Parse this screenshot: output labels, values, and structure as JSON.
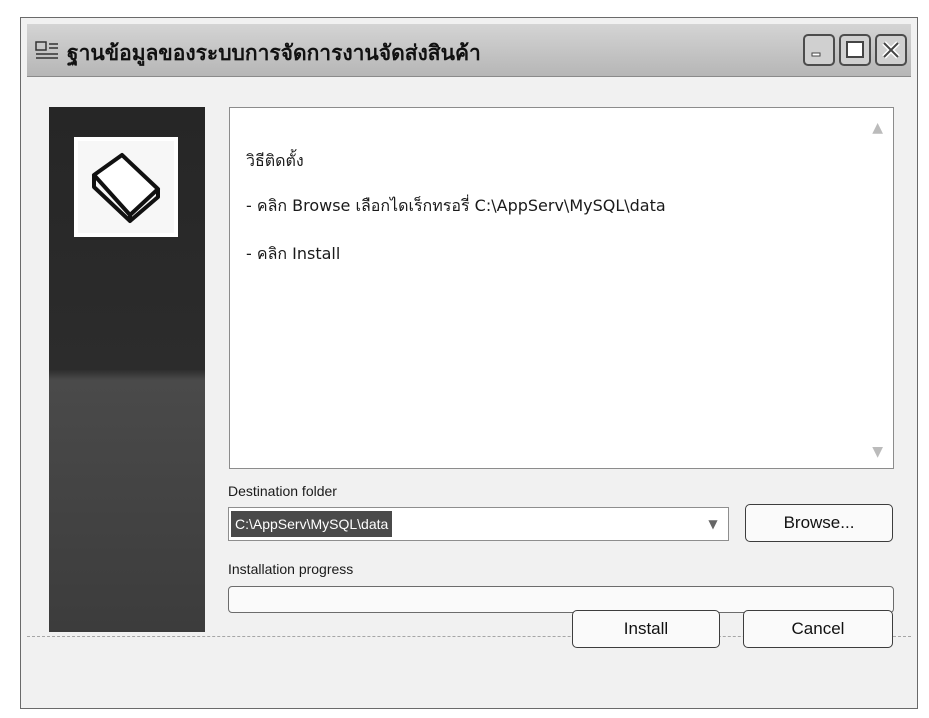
{
  "window": {
    "title": "ฐานข้อมูลของระบบการจัดการงานจัดส่งสินค้า"
  },
  "info": {
    "heading": "วิธีติดตั้ง",
    "steps": [
      "- คลิก Browse เลือกไดเร็กทรอรี่ C:\\AppServ\\MySQL\\data",
      "- คลิก Install"
    ]
  },
  "destination": {
    "label": "Destination folder",
    "value": "C:\\AppServ\\MySQL\\data",
    "browse_label": "Browse..."
  },
  "progress": {
    "label": "Installation progress",
    "value": 0
  },
  "buttons": {
    "install": "Install",
    "cancel": "Cancel"
  }
}
